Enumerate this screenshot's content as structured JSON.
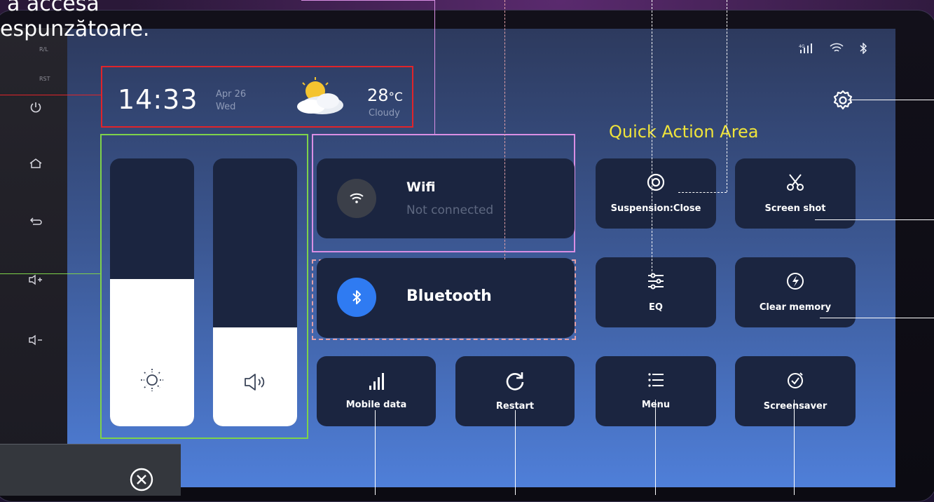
{
  "headline": {
    "line1": "a accesa",
    "line2": "espunzătoare."
  },
  "left_strip": {
    "labels": [
      "R/L",
      "RST"
    ],
    "buttons": [
      "power-icon",
      "home-icon",
      "back-icon",
      "volume-up-icon",
      "volume-down-icon"
    ]
  },
  "status_bar": {
    "signal_label": "4G",
    "icons": [
      "cellular-signal-icon",
      "wifi-icon",
      "bluetooth-icon"
    ]
  },
  "clock": {
    "time": "14:33",
    "date": "Apr 26",
    "weekday": "Wed"
  },
  "weather": {
    "temperature": "28",
    "unit": "°C",
    "condition": "Cloudy",
    "icon": "partly-cloudy-icon"
  },
  "quick_action_title": "Quick Action Area",
  "sliders": [
    {
      "name": "brightness",
      "icon": "sun-icon",
      "level": 0.55
    },
    {
      "name": "volume",
      "icon": "speaker-icon",
      "level": 0.37
    }
  ],
  "connections": {
    "wifi": {
      "label": "Wifi",
      "status": "Not connected",
      "icon": "wifi-icon",
      "badge_color": "#3b3f49"
    },
    "bluetooth": {
      "label": "Bluetooth",
      "icon": "bluetooth-icon",
      "badge_color": "#2f7bf2"
    }
  },
  "actions": [
    {
      "id": "suspension",
      "label": "Suspension:Close",
      "icon": "suspension-icon"
    },
    {
      "id": "screenshot",
      "label": "Screen shot",
      "icon": "scissors-icon"
    },
    {
      "id": "eq",
      "label": "EQ",
      "icon": "equalizer-icon"
    },
    {
      "id": "clear-memory",
      "label": "Clear memory",
      "icon": "lightning-icon"
    },
    {
      "id": "mobile-data",
      "label": "Mobile data",
      "icon": "mobile-data-icon"
    },
    {
      "id": "restart",
      "label": "Restart",
      "icon": "restart-icon"
    },
    {
      "id": "menu",
      "label": "Menu",
      "icon": "menu-icon"
    },
    {
      "id": "screensaver",
      "label": "Screensaver",
      "icon": "screensaver-icon"
    }
  ],
  "colors": {
    "accent_blue": "#2f7bf2",
    "tile": "#1b2540",
    "title_yellow": "#f0e43a",
    "time_box_border": "#e0242a",
    "slider_box_border": "#7ed24a",
    "wifi_box_border": "#d98fe4"
  }
}
